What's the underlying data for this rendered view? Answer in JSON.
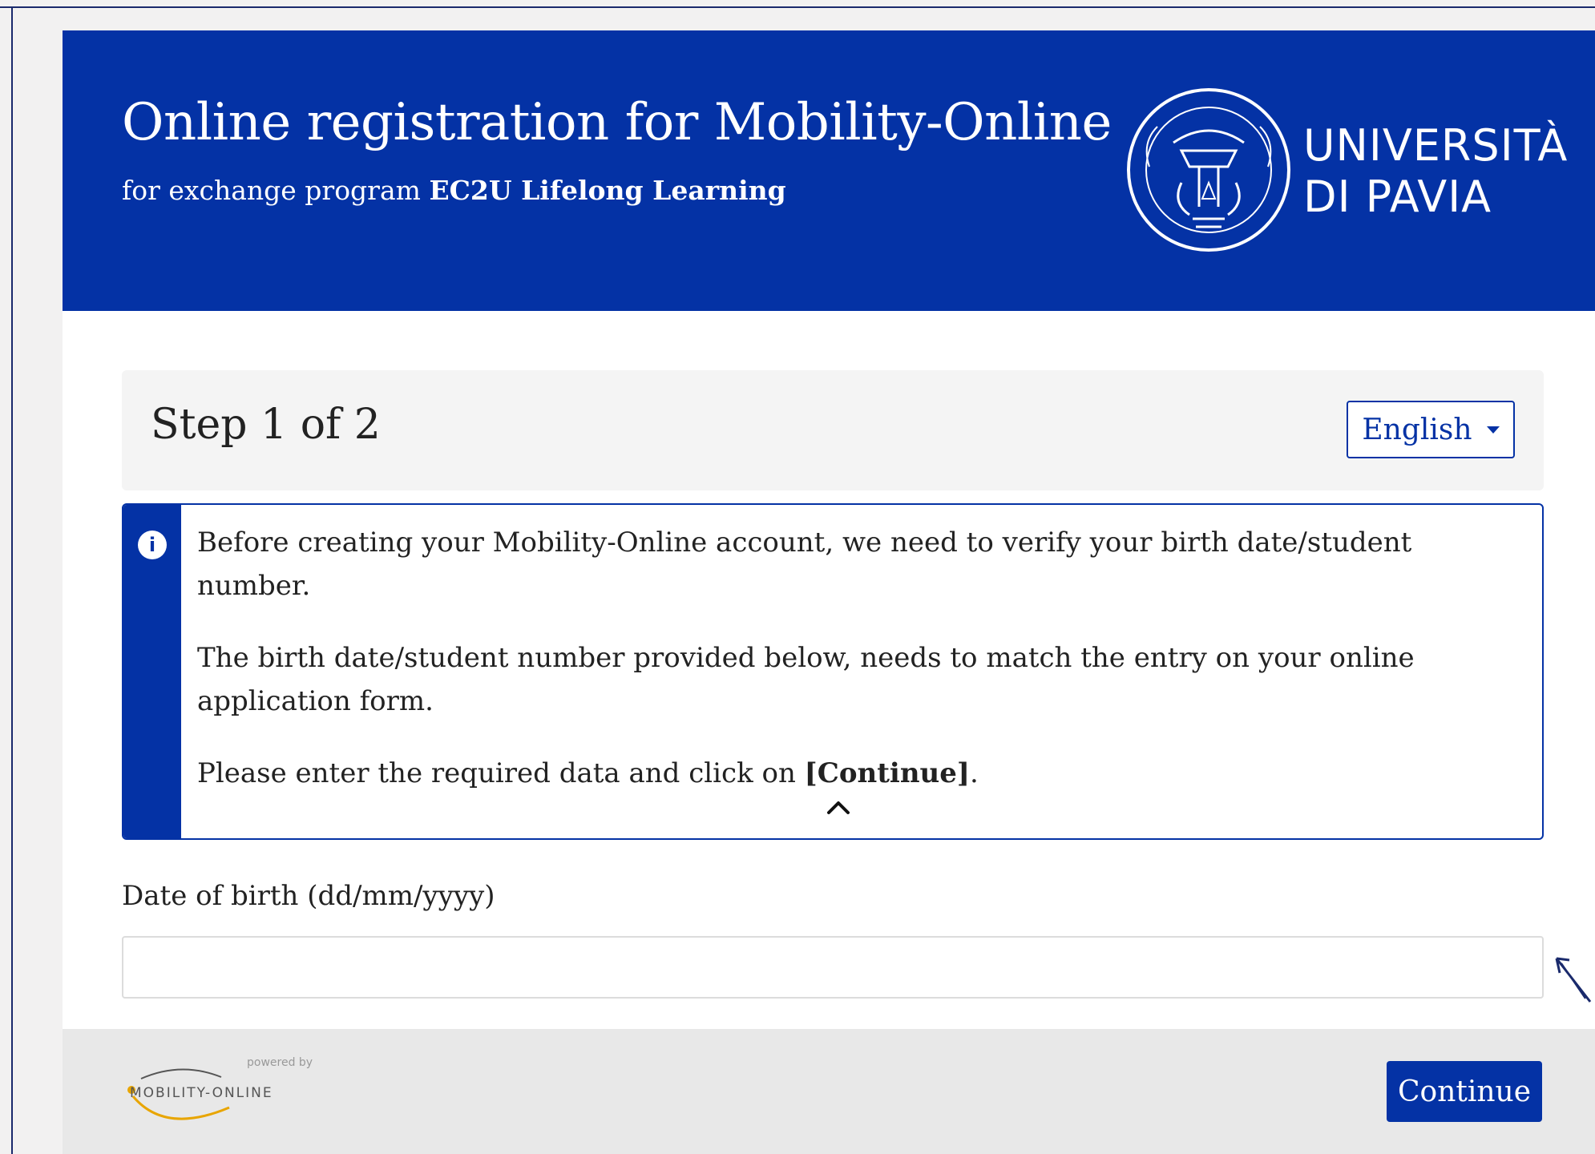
{
  "header": {
    "title": "Online registration for Mobility-Online",
    "subtitle_prefix": "for exchange program",
    "program": "EC2U Lifelong Learning",
    "university_line1": "UNIVERSITÀ",
    "university_line2": "DI PAVIA",
    "bg_color": "#0432a5"
  },
  "step": {
    "title": "Step 1 of 2",
    "language": "English"
  },
  "info": {
    "icon": "info-icon",
    "paragraph1": "Before creating your Mobility-Online account, we need to verify your birth date/student number.",
    "paragraph2": "The birth date/student number provided below, needs to match the entry on your online application form.",
    "paragraph3_prefix": "Please enter the required data and click on",
    "paragraph3_button": "[Continue]",
    "paragraph3_suffix": "."
  },
  "form": {
    "dob_label": "Date of birth (dd/mm/yyyy)",
    "dob_value": ""
  },
  "footer": {
    "powered_by": "powered by",
    "logo_text": "MOBILITY-ONLINE",
    "continue_label": "Continue"
  }
}
